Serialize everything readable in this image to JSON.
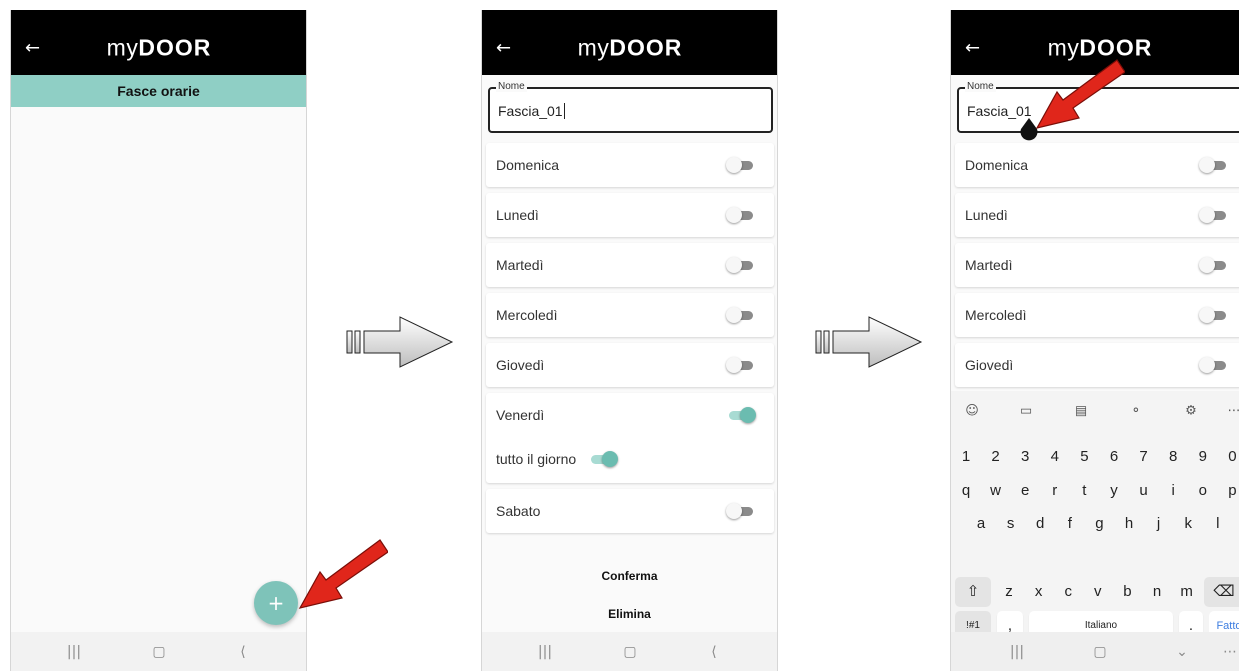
{
  "app": {
    "logo_prefix": "my",
    "logo_suffix": "DOOR",
    "back_icon": "back-arrow-icon"
  },
  "screen1": {
    "header": "Fasce orarie",
    "fab_label": "+"
  },
  "form": {
    "name_label": "Nome",
    "name_value": "Fascia_01",
    "days": [
      "Domenica",
      "Lunedì",
      "Martedì",
      "Mercoledì",
      "Giovedì",
      "Venerdì",
      "Sabato"
    ],
    "friday_on": true,
    "all_day_label": "tutto il giorno",
    "all_day_on": true,
    "confirm_label": "Conferma",
    "delete_label": "Elimina"
  },
  "keyboard": {
    "toolbar_icons": [
      "emoji-icon",
      "clipboard-icon",
      "notes-icon",
      "mic-icon",
      "settings-icon",
      "more-icon"
    ],
    "row_numbers": [
      "1",
      "2",
      "3",
      "4",
      "5",
      "6",
      "7",
      "8",
      "9",
      "0"
    ],
    "row_1": [
      "q",
      "w",
      "e",
      "r",
      "t",
      "y",
      "u",
      "i",
      "o",
      "p"
    ],
    "row_2": [
      "a",
      "s",
      "d",
      "f",
      "g",
      "h",
      "j",
      "k",
      "l"
    ],
    "row_3": [
      "z",
      "x",
      "c",
      "v",
      "b",
      "n",
      "m"
    ],
    "symbols_key": "!#1",
    "comma_key": ",",
    "space_label": "Italiano",
    "period_key": ".",
    "done_key": "Fatto"
  },
  "colors": {
    "accent": "#8fcfc5",
    "toggle_on": "#6bbcb0",
    "appbar": "#000000",
    "arrow_red": "#e0261b"
  }
}
